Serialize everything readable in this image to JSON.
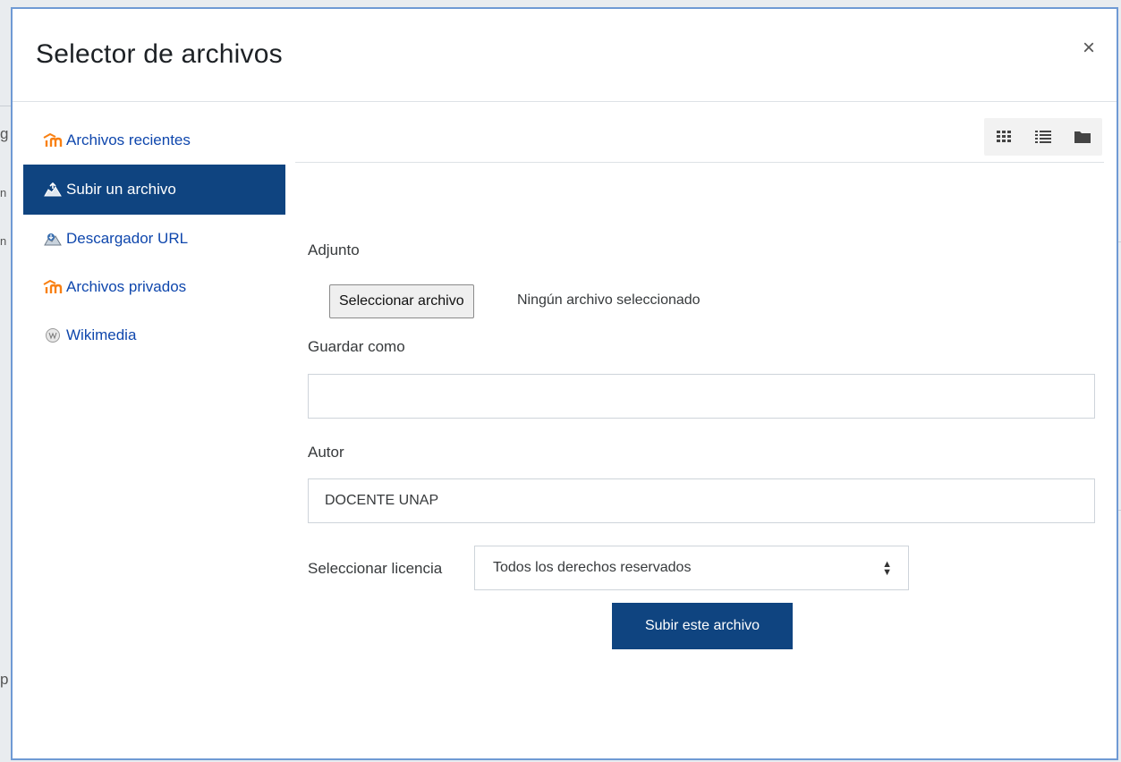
{
  "dialog": {
    "title": "Selector de archivos",
    "close_label": "×"
  },
  "sidebar": {
    "items": [
      {
        "label": "Archivos recientes",
        "icon": "moodle-icon",
        "active": false
      },
      {
        "label": "Subir un archivo",
        "icon": "upload-icon",
        "active": true
      },
      {
        "label": "Descargador URL",
        "icon": "url-download-icon",
        "active": false
      },
      {
        "label": "Archivos privados",
        "icon": "moodle-icon",
        "active": false
      },
      {
        "label": "Wikimedia",
        "icon": "wikimedia-icon",
        "active": false
      }
    ]
  },
  "toolbar": {
    "views": [
      "grid-view-icon",
      "list-view-icon",
      "folder-view-icon"
    ]
  },
  "form": {
    "attachment_label": "Adjunto",
    "file_button": "Seleccionar archivo",
    "file_status": "Ningún archivo seleccionado",
    "save_as_label": "Guardar como",
    "save_as_value": "",
    "author_label": "Autor",
    "author_value": "DOCENTE UNAP",
    "license_label": "Seleccionar licencia",
    "license_value": "Todos los derechos reservados",
    "submit_label": "Subir este archivo"
  },
  "colors": {
    "primary": "#0f4480",
    "link": "#0f47ad",
    "modal_border": "#6f9ad4"
  }
}
